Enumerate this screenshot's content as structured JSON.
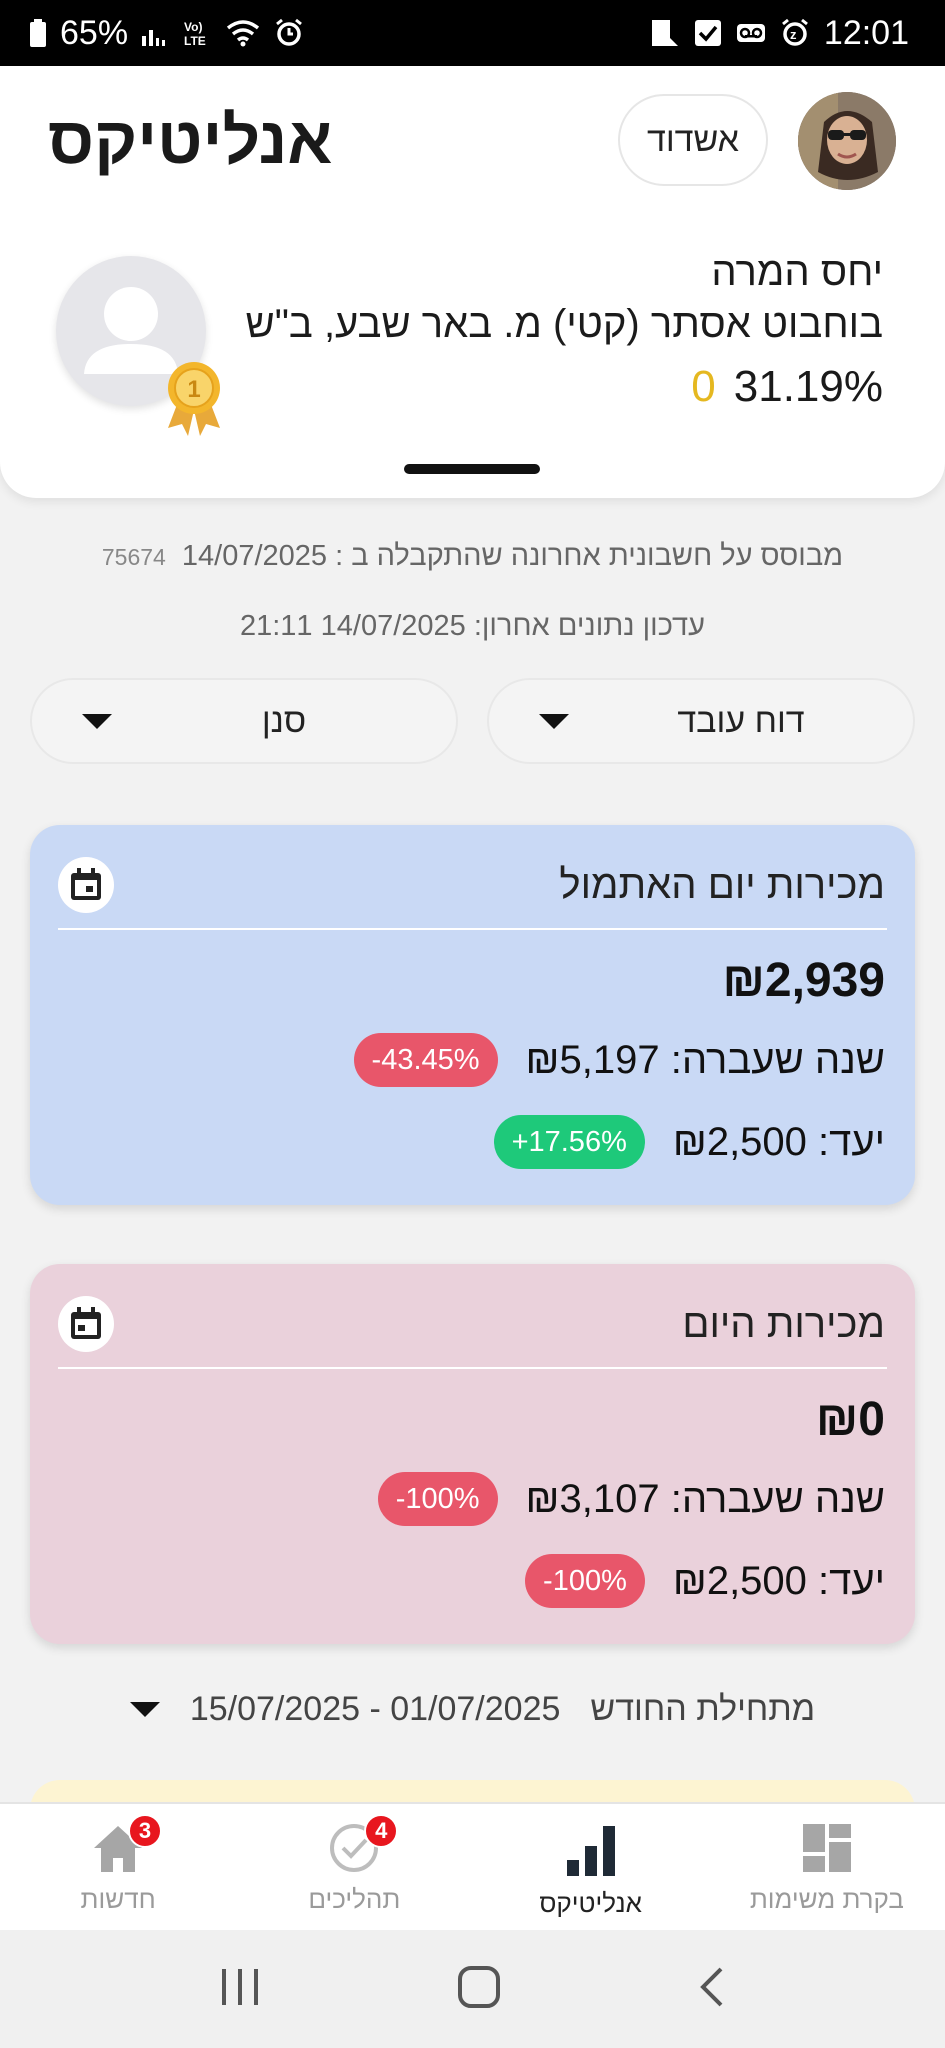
{
  "status_bar": {
    "battery": "65%",
    "time": "12:01"
  },
  "header": {
    "title": "אנליטיקס",
    "city_button": "אשדוד"
  },
  "profile": {
    "conversion_label": "יחס המרה",
    "store_name": "בוחבוט אסתר (קטי) מ. באר שבע, ב\"ש",
    "conversion_value": "31.19%",
    "medal_count": "0",
    "medal_rank": "1"
  },
  "info": {
    "based_on": "מבוסס על חשבונית אחרונה שהתקבלה ב : 14/07/2025",
    "invoice_id": "75674",
    "last_update": "עדכון נתונים אחרון: 14/07/2025 21:11"
  },
  "filters": {
    "report": "דוח עובד",
    "branch": "סנן"
  },
  "cards": {
    "yesterday": {
      "title": "מכירות יום האתמול",
      "amount": "₪2,939",
      "last_year": "שנה שעברה: ₪5,197",
      "last_year_change": "-43.45%",
      "target": "יעד: ₪2,500",
      "target_change": "+17.56%"
    },
    "today": {
      "title": "מכירות היום",
      "amount": "₪0",
      "last_year": "שנה שעברה: ₪3,107",
      "last_year_change": "-100%",
      "target": "יעד: ₪2,500",
      "target_change": "-100%"
    }
  },
  "date_range": {
    "label": "מתחילת החודש",
    "range": "15/07/2025 - 01/07/2025"
  },
  "bottom_nav": {
    "items": [
      {
        "label": "חדשות",
        "badge": "3"
      },
      {
        "label": "תהליכים",
        "badge": "4"
      },
      {
        "label": "אנליטיקס"
      },
      {
        "label": "בקרת משימות"
      }
    ]
  },
  "colors": {
    "yesterday_card": "#c9d9f5",
    "today_card": "#ead1db",
    "negative_badge": "#e8566a",
    "positive_badge": "#1ec97a",
    "medal_gold": "#e5b820",
    "nav_badge": "#e8161e"
  },
  "icons": [
    "battery-icon",
    "signal-icon",
    "volte-icon",
    "wifi-icon",
    "alarm-icon",
    "calendar-icon",
    "home-icon",
    "check-circle-icon",
    "bar-chart-icon",
    "dashboard-icon",
    "recents-icon",
    "home-button-icon",
    "back-icon"
  ]
}
